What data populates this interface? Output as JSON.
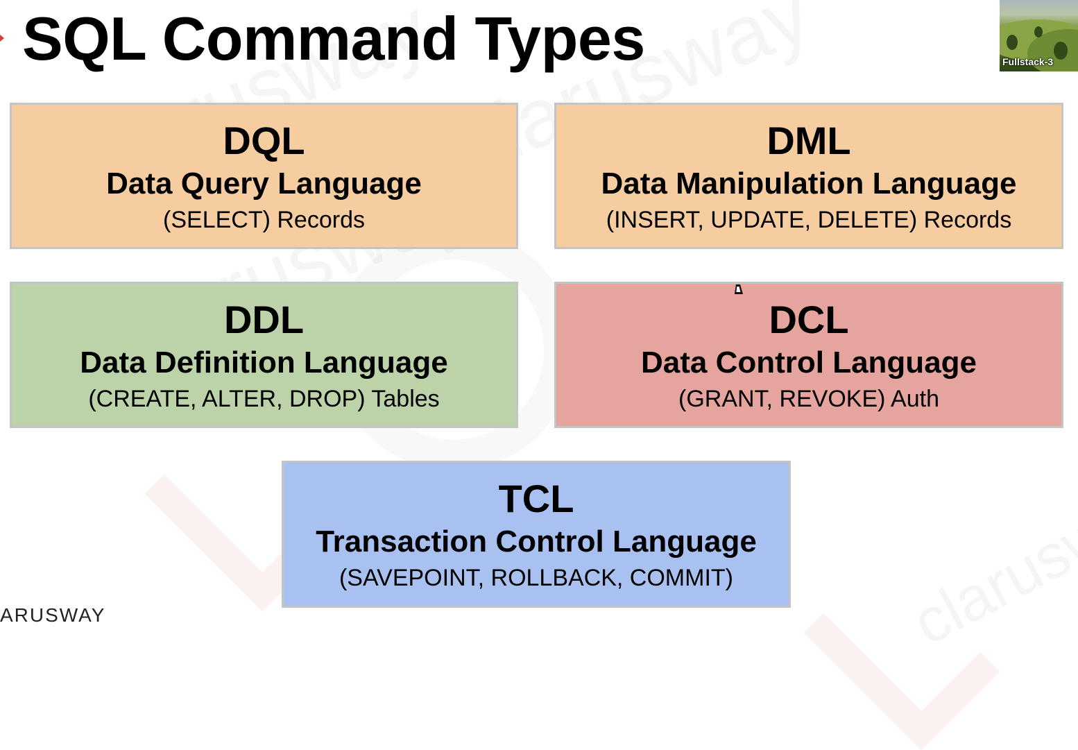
{
  "slide": {
    "title": "SQL Command Types"
  },
  "video_thumbnail": {
    "label": "Fullstack-3"
  },
  "watermark": {
    "text": "clarusway"
  },
  "cards": [
    {
      "abbr": "DQL",
      "name": "Data Query Language",
      "commands": "(SELECT) Records",
      "color": "#f6cda0"
    },
    {
      "abbr": "DML",
      "name": "Data Manipulation Language",
      "commands": "(INSERT, UPDATE, DELETE) Records",
      "color": "#f6cda0"
    },
    {
      "abbr": "DDL",
      "name": "Data Definition Language",
      "commands": "(CREATE, ALTER, DROP) Tables",
      "color": "#bcd3aa"
    },
    {
      "abbr": "DCL",
      "name": "Data Control Language",
      "commands": "(GRANT, REVOKE) Auth",
      "color": "#e6a49e"
    },
    {
      "abbr": "TCL",
      "name": "Transaction Control Language",
      "commands": "(SAVEPOINT, ROLLBACK, COMMIT)",
      "color": "#a9c1f1"
    }
  ],
  "footer": {
    "brand": "ARUSWAY"
  },
  "icons": {
    "cursor": "mouse-pointer-icon",
    "slide_marker": "red-arrow-marker-icon"
  }
}
